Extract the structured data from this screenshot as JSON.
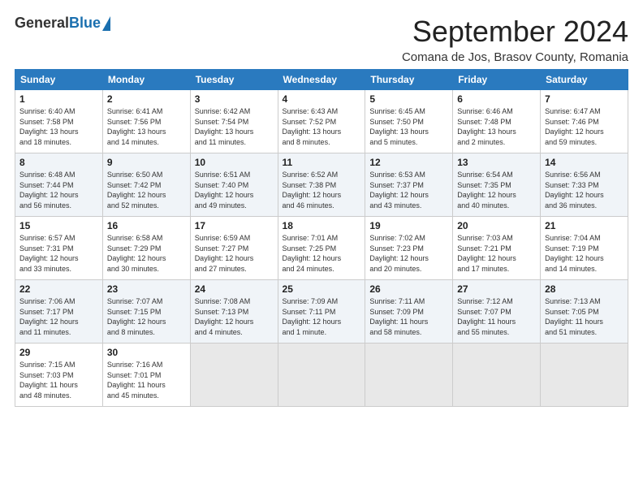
{
  "header": {
    "logo_general": "General",
    "logo_blue": "Blue",
    "month_title": "September 2024",
    "location": "Comana de Jos, Brasov County, Romania"
  },
  "weekdays": [
    "Sunday",
    "Monday",
    "Tuesday",
    "Wednesday",
    "Thursday",
    "Friday",
    "Saturday"
  ],
  "weeks": [
    [
      {
        "day": "1",
        "info": "Sunrise: 6:40 AM\nSunset: 7:58 PM\nDaylight: 13 hours\nand 18 minutes."
      },
      {
        "day": "2",
        "info": "Sunrise: 6:41 AM\nSunset: 7:56 PM\nDaylight: 13 hours\nand 14 minutes."
      },
      {
        "day": "3",
        "info": "Sunrise: 6:42 AM\nSunset: 7:54 PM\nDaylight: 13 hours\nand 11 minutes."
      },
      {
        "day": "4",
        "info": "Sunrise: 6:43 AM\nSunset: 7:52 PM\nDaylight: 13 hours\nand 8 minutes."
      },
      {
        "day": "5",
        "info": "Sunrise: 6:45 AM\nSunset: 7:50 PM\nDaylight: 13 hours\nand 5 minutes."
      },
      {
        "day": "6",
        "info": "Sunrise: 6:46 AM\nSunset: 7:48 PM\nDaylight: 13 hours\nand 2 minutes."
      },
      {
        "day": "7",
        "info": "Sunrise: 6:47 AM\nSunset: 7:46 PM\nDaylight: 12 hours\nand 59 minutes."
      }
    ],
    [
      {
        "day": "8",
        "info": "Sunrise: 6:48 AM\nSunset: 7:44 PM\nDaylight: 12 hours\nand 56 minutes."
      },
      {
        "day": "9",
        "info": "Sunrise: 6:50 AM\nSunset: 7:42 PM\nDaylight: 12 hours\nand 52 minutes."
      },
      {
        "day": "10",
        "info": "Sunrise: 6:51 AM\nSunset: 7:40 PM\nDaylight: 12 hours\nand 49 minutes."
      },
      {
        "day": "11",
        "info": "Sunrise: 6:52 AM\nSunset: 7:38 PM\nDaylight: 12 hours\nand 46 minutes."
      },
      {
        "day": "12",
        "info": "Sunrise: 6:53 AM\nSunset: 7:37 PM\nDaylight: 12 hours\nand 43 minutes."
      },
      {
        "day": "13",
        "info": "Sunrise: 6:54 AM\nSunset: 7:35 PM\nDaylight: 12 hours\nand 40 minutes."
      },
      {
        "day": "14",
        "info": "Sunrise: 6:56 AM\nSunset: 7:33 PM\nDaylight: 12 hours\nand 36 minutes."
      }
    ],
    [
      {
        "day": "15",
        "info": "Sunrise: 6:57 AM\nSunset: 7:31 PM\nDaylight: 12 hours\nand 33 minutes."
      },
      {
        "day": "16",
        "info": "Sunrise: 6:58 AM\nSunset: 7:29 PM\nDaylight: 12 hours\nand 30 minutes."
      },
      {
        "day": "17",
        "info": "Sunrise: 6:59 AM\nSunset: 7:27 PM\nDaylight: 12 hours\nand 27 minutes."
      },
      {
        "day": "18",
        "info": "Sunrise: 7:01 AM\nSunset: 7:25 PM\nDaylight: 12 hours\nand 24 minutes."
      },
      {
        "day": "19",
        "info": "Sunrise: 7:02 AM\nSunset: 7:23 PM\nDaylight: 12 hours\nand 20 minutes."
      },
      {
        "day": "20",
        "info": "Sunrise: 7:03 AM\nSunset: 7:21 PM\nDaylight: 12 hours\nand 17 minutes."
      },
      {
        "day": "21",
        "info": "Sunrise: 7:04 AM\nSunset: 7:19 PM\nDaylight: 12 hours\nand 14 minutes."
      }
    ],
    [
      {
        "day": "22",
        "info": "Sunrise: 7:06 AM\nSunset: 7:17 PM\nDaylight: 12 hours\nand 11 minutes."
      },
      {
        "day": "23",
        "info": "Sunrise: 7:07 AM\nSunset: 7:15 PM\nDaylight: 12 hours\nand 8 minutes."
      },
      {
        "day": "24",
        "info": "Sunrise: 7:08 AM\nSunset: 7:13 PM\nDaylight: 12 hours\nand 4 minutes."
      },
      {
        "day": "25",
        "info": "Sunrise: 7:09 AM\nSunset: 7:11 PM\nDaylight: 12 hours\nand 1 minute."
      },
      {
        "day": "26",
        "info": "Sunrise: 7:11 AM\nSunset: 7:09 PM\nDaylight: 11 hours\nand 58 minutes."
      },
      {
        "day": "27",
        "info": "Sunrise: 7:12 AM\nSunset: 7:07 PM\nDaylight: 11 hours\nand 55 minutes."
      },
      {
        "day": "28",
        "info": "Sunrise: 7:13 AM\nSunset: 7:05 PM\nDaylight: 11 hours\nand 51 minutes."
      }
    ],
    [
      {
        "day": "29",
        "info": "Sunrise: 7:15 AM\nSunset: 7:03 PM\nDaylight: 11 hours\nand 48 minutes."
      },
      {
        "day": "30",
        "info": "Sunrise: 7:16 AM\nSunset: 7:01 PM\nDaylight: 11 hours\nand 45 minutes."
      },
      {
        "day": "",
        "info": ""
      },
      {
        "day": "",
        "info": ""
      },
      {
        "day": "",
        "info": ""
      },
      {
        "day": "",
        "info": ""
      },
      {
        "day": "",
        "info": ""
      }
    ]
  ]
}
